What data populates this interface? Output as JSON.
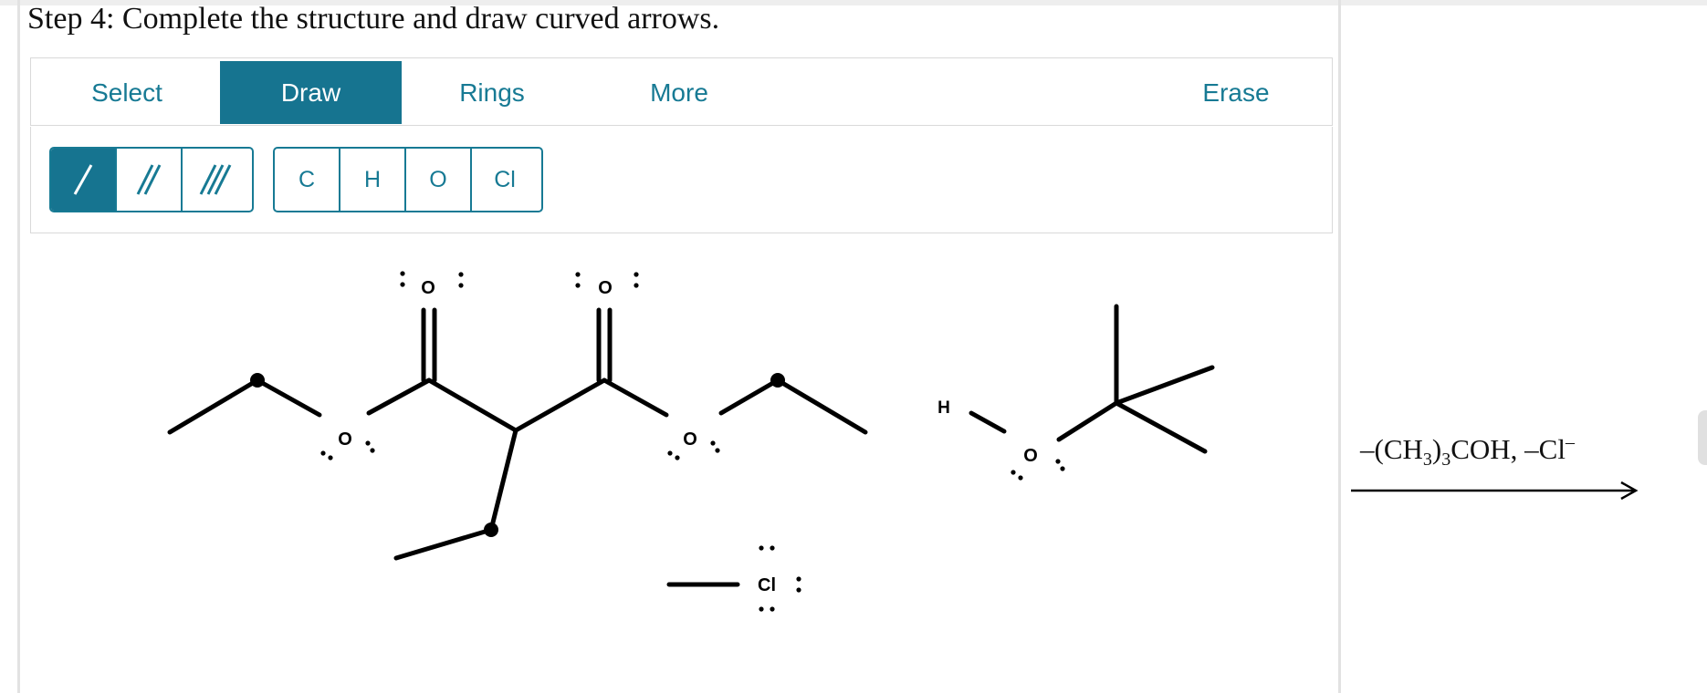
{
  "step": {
    "title": "Step 4: Complete the structure and draw curved arrows."
  },
  "toolbar": {
    "tabs": [
      {
        "label": "Select"
      },
      {
        "label": "Draw"
      },
      {
        "label": "Rings"
      },
      {
        "label": "More"
      },
      {
        "label": "Erase"
      }
    ],
    "active_tab": "Draw"
  },
  "bond_tools": [
    {
      "icon": "single-bond-icon"
    },
    {
      "icon": "double-bond-icon"
    },
    {
      "icon": "triple-bond-icon"
    }
  ],
  "atom_tools": [
    {
      "label": "C"
    },
    {
      "label": "H"
    },
    {
      "label": "O"
    },
    {
      "label": "Cl"
    }
  ],
  "molecule_labels": {
    "o_carbonyl_left": "O",
    "o_carbonyl_right": "O",
    "o_ester_left": "O",
    "o_ester_right": "O",
    "h_alcohol": "H",
    "o_alcohol": "O",
    "cl": "Cl"
  },
  "reaction": {
    "prefix": "–(CH",
    "sub1": "3",
    "mid1": ")",
    "sub2": "3",
    "mid2": "COH, –Cl",
    "sup": "–"
  },
  "colors": {
    "accent": "#177a94",
    "accent_dark": "#167490"
  }
}
